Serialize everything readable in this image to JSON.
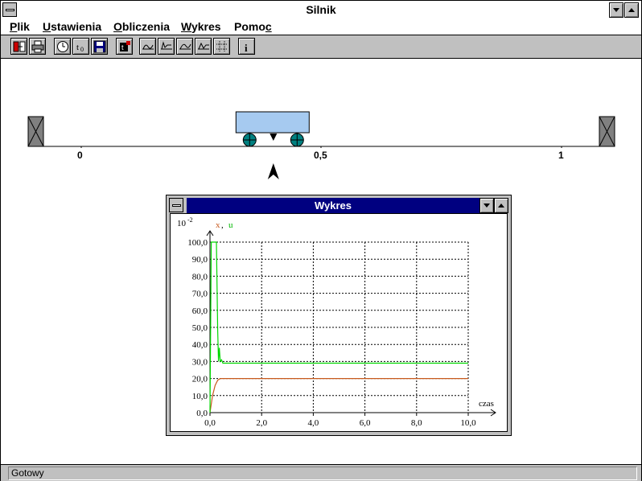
{
  "window": {
    "title": "Silnik"
  },
  "menu": {
    "items": [
      {
        "key": "P",
        "rest": "lik"
      },
      {
        "key": "U",
        "rest": "stawienia"
      },
      {
        "key": "O",
        "rest": "bliczenia"
      },
      {
        "key": "W",
        "rest": "ykres"
      },
      {
        "pre": "Pomo",
        "key": "c",
        "rest": ""
      }
    ]
  },
  "toolbar": {
    "buttons": [
      "exit-icon",
      "print-icon",
      "clock-icon",
      "time-step-icon",
      "save-icon",
      "controller-icon",
      "response-icon-1",
      "response-icon-2",
      "response-icon-3",
      "response-icon-4",
      "grid-icon",
      "info-icon"
    ]
  },
  "scene": {
    "scale_labels": [
      "0",
      "0,5",
      "1"
    ],
    "cart_position": 0.4,
    "setpoint_position": 0.4
  },
  "chart_window": {
    "title": "Wykres",
    "exponent_base": "10",
    "exponent_power": "-2",
    "legend_x": "x",
    "legend_sep": ",",
    "legend_u": "u",
    "xlabel": "czas"
  },
  "chart_data": {
    "type": "line",
    "title": "",
    "xlabel": "czas",
    "ylabel": "x, u",
    "y_multiplier": "10^-2",
    "xlim": [
      0,
      10
    ],
    "ylim": [
      0,
      100
    ],
    "xticks": [
      "0,0",
      "2,0",
      "4,0",
      "6,0",
      "8,0",
      "10,0"
    ],
    "yticks": [
      "0,0",
      "10,0",
      "20,0",
      "30,0",
      "40,0",
      "50,0",
      "60,0",
      "70,0",
      "80,0",
      "90,0",
      "100,0"
    ],
    "grid": true,
    "series": [
      {
        "name": "x",
        "color": "#c85a1e",
        "x": [
          0,
          0.1,
          0.2,
          0.3,
          0.4,
          0.6,
          1.0,
          10.0
        ],
        "y": [
          0,
          10,
          16,
          19,
          20,
          20,
          20,
          20
        ]
      },
      {
        "name": "u",
        "color": "#00d800",
        "x": [
          0,
          0.05,
          0.1,
          0.15,
          0.2,
          0.25,
          0.3,
          0.33,
          0.36,
          0.4,
          0.45,
          0.5,
          0.6,
          0.8,
          1.0,
          10.0
        ],
        "y": [
          0,
          100,
          100,
          100,
          100,
          100,
          48,
          30,
          38,
          30,
          31,
          29,
          29,
          29,
          29,
          29
        ]
      }
    ]
  },
  "status": {
    "text": "Gotowy"
  }
}
